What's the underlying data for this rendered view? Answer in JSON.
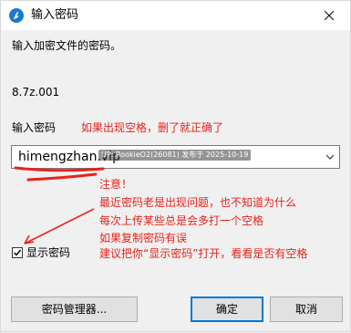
{
  "window": {
    "title": "输入密码"
  },
  "dialog": {
    "prompt": "输入加密文件的密码。",
    "filename": "8.7z.001",
    "password_label": "输入密码",
    "password_value": "himengzhan.vip",
    "watermark_text": "UP: RookieO2(26081) 发布于 2025-10-19",
    "show_password_label": "显示密码",
    "show_password_checked": true
  },
  "buttons": {
    "password_manager": "密码管理器...",
    "ok": "确定",
    "cancel": "取消"
  },
  "annotations": {
    "top_note": "如果出现空格，删了就正确了",
    "lines": [
      "注意！",
      "最近密码老是出现问题，也不知道为什么",
      "每次上传某些总是会多打一个空格",
      "如果复制密码有误",
      "建议把你“显示密码”打开，看看是否有空格"
    ]
  },
  "icons": {
    "app": "app-logo-icon",
    "close": "close-icon",
    "dropdown": "chevron-down-icon",
    "check": "check-icon"
  },
  "colors": {
    "annotation": "#e8231b",
    "default_button_border": "#0078d7",
    "app_icon": "#1e78d2"
  }
}
